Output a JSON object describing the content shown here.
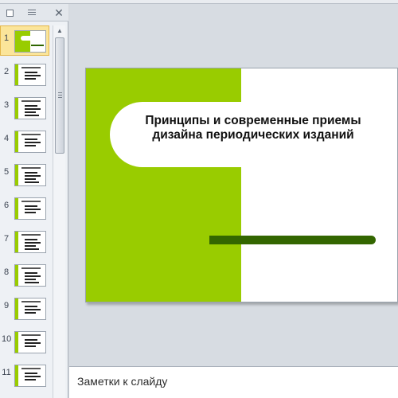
{
  "panel": {
    "close_label": "✕"
  },
  "slide": {
    "title": "Принципы  и современные приемы  дизайна  периодических изданий",
    "colors": {
      "green": "#99cc00",
      "dark_green_bar": "#336600",
      "background": "#ffffff"
    }
  },
  "thumbnails": [
    {
      "number": "1"
    },
    {
      "number": "2"
    },
    {
      "number": "3"
    },
    {
      "number": "4"
    },
    {
      "number": "5"
    },
    {
      "number": "6"
    },
    {
      "number": "7"
    },
    {
      "number": "8"
    },
    {
      "number": "9"
    },
    {
      "number": "10"
    },
    {
      "number": "11"
    }
  ],
  "notes": {
    "placeholder": "Заметки к слайду"
  }
}
